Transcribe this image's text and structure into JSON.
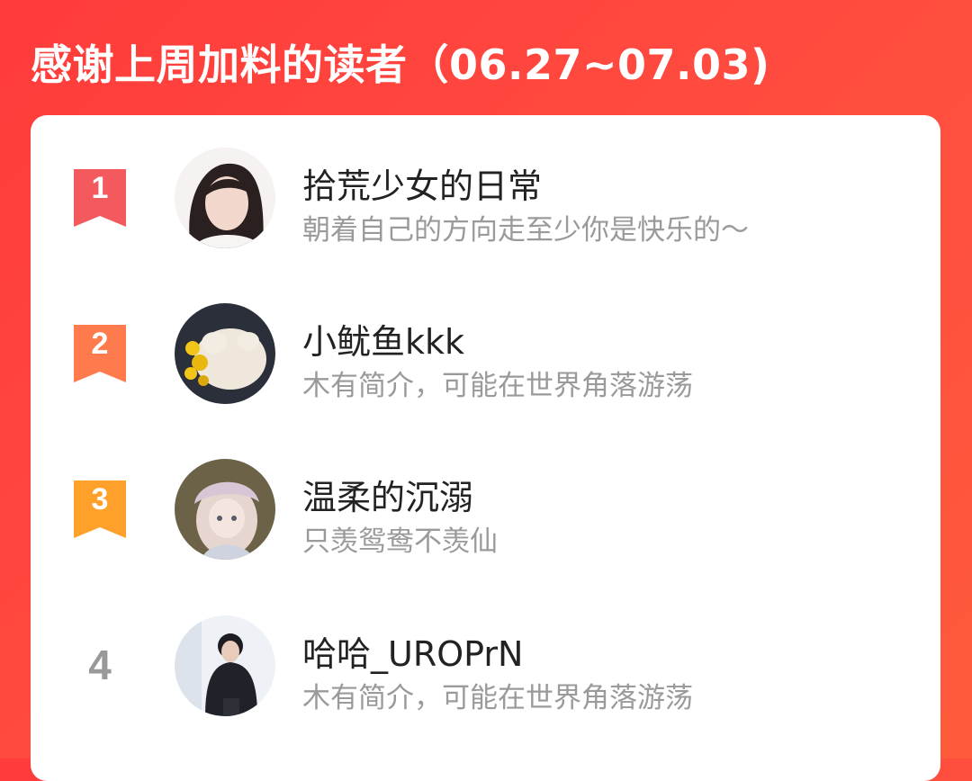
{
  "header": {
    "title": "感谢上周加料的读者（06.27~07.03)"
  },
  "readers": [
    {
      "rank": "1",
      "name": "拾荒少女的日常",
      "bio": "朝着自己的方向走至少你是快乐的～"
    },
    {
      "rank": "2",
      "name": "小鱿鱼kkk",
      "bio": "木有简介，可能在世界角落游荡"
    },
    {
      "rank": "3",
      "name": "温柔的沉溺",
      "bio": "只羡鸳鸯不羡仙"
    },
    {
      "rank": "4",
      "name": "哈哈_UROPrN",
      "bio": "木有简介，可能在世界角落游荡"
    }
  ],
  "colors": {
    "background": "#ff4a3f",
    "rank1": "#f45a5d",
    "rank2": "#ff7a4c",
    "rank3": "#ffa02a",
    "rank_plain": "#999999"
  }
}
